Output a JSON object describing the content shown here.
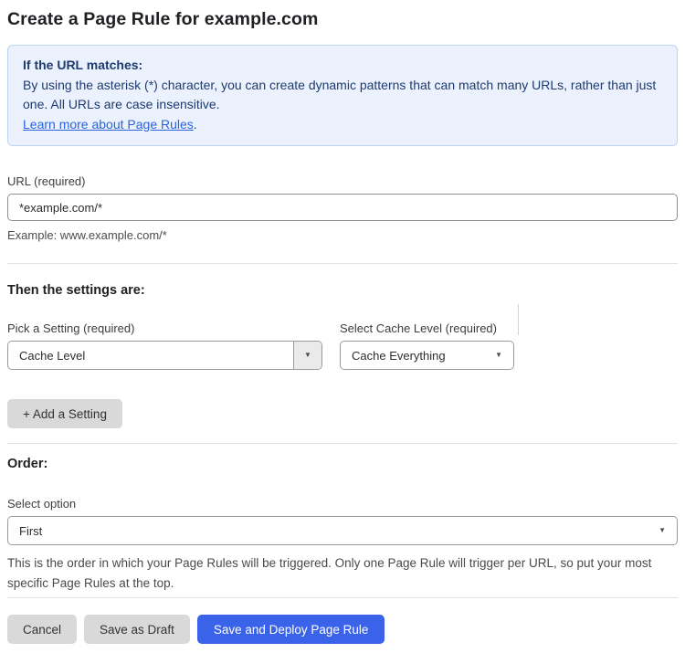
{
  "page": {
    "title": "Create a Page Rule for example.com"
  },
  "info_box": {
    "heading": "If the URL matches:",
    "body": "By using the asterisk (*) character, you can create dynamic patterns that can match many URLs, rather than just one. All URLs are case insensitive.",
    "link_label": "Learn more about Page Rules",
    "link_suffix": "."
  },
  "url_field": {
    "label": "URL (required)",
    "value": "*example.com/*",
    "helper": "Example: www.example.com/*"
  },
  "settings_section": {
    "heading": "Then the settings are:",
    "setting_picker": {
      "label": "Pick a Setting (required)",
      "value": "Cache Level"
    },
    "cache_level_picker": {
      "label": "Select Cache Level (required)",
      "value": "Cache Everything"
    },
    "add_setting_label": "+ Add a Setting"
  },
  "order_section": {
    "heading": "Order:",
    "label": "Select option",
    "value": "First",
    "helper": "This is the order in which your Page Rules will be triggered. Only one Page Rule will trigger per URL, so put your most specific Page Rules at the top."
  },
  "actions": {
    "cancel": "Cancel",
    "save_draft": "Save as Draft",
    "save_deploy": "Save and Deploy Page Rule"
  },
  "icons": {
    "dropdown_arrow": "▼"
  },
  "colors": {
    "accent_blue": "#3B63EA",
    "info_background": "#EBF2FD",
    "info_border": "#B9D3F3",
    "info_text": "#1E3A6E",
    "link_blue": "#2C62D9",
    "button_gray": "#D9D9D9"
  }
}
